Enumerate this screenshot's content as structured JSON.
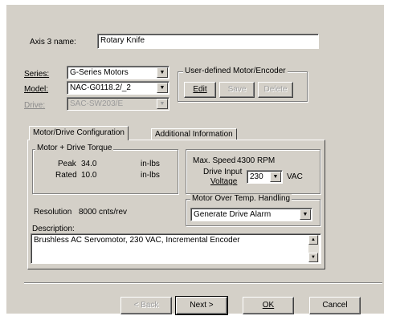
{
  "axis": {
    "label": "Axis 3 name:",
    "value": "Rotary Knife"
  },
  "motor": {
    "series_label": "Series:",
    "series_value": "G-Series Motors",
    "model_label": "Model:",
    "model_value": "NAC-G0118.2/_2",
    "drive_label": "Drive:",
    "drive_value": "SAC-SW203/E"
  },
  "user_defined": {
    "title": "User-defined Motor/Encoder",
    "edit": "Edit",
    "save": "Save",
    "delete": "Delete"
  },
  "tabs": [
    {
      "label": "Motor/Drive Configuration",
      "active": true
    },
    {
      "label": "Additional Information",
      "active": false
    }
  ],
  "torque": {
    "title": "Motor + Drive Torque",
    "peak_label": "Peak",
    "peak_value": "34.0",
    "peak_unit": "in-lbs",
    "rated_label": "Rated",
    "rated_value": "10.0",
    "rated_unit": "in-lbs"
  },
  "speed": {
    "label": "Max. Speed",
    "value": "4300 RPM",
    "drive_input_label": "Drive Input",
    "voltage_label": "Voltage",
    "voltage_value": "230",
    "voltage_unit": "VAC"
  },
  "resolution": {
    "label": "Resolution",
    "value": "8000 cnts/rev"
  },
  "overtemp": {
    "title": "Motor Over Temp. Handling",
    "value": "Generate Drive Alarm"
  },
  "description": {
    "label": "Description:",
    "text": "Brushless AC Servomotor, 230 VAC, Incremental Encoder"
  },
  "footer": {
    "back": "< Back",
    "next": "Next >",
    "ok": "OK",
    "cancel": "Cancel"
  }
}
